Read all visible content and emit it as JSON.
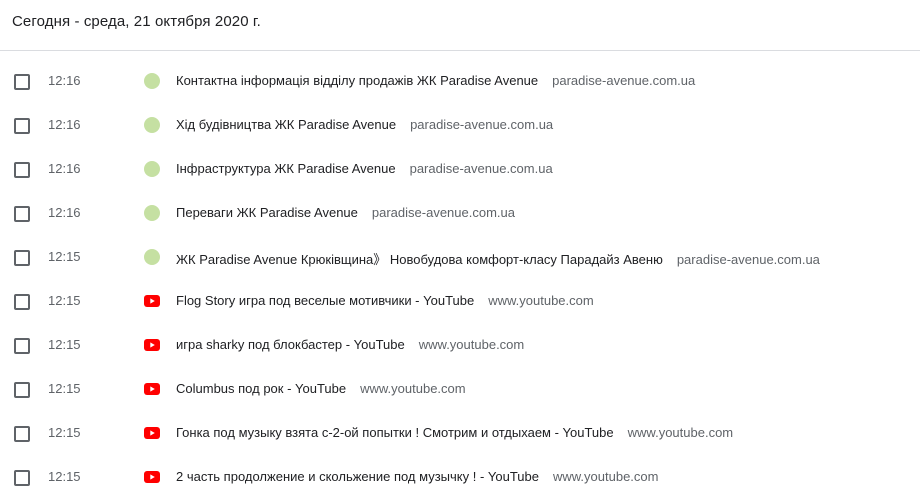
{
  "header": {
    "title": "Сегодня - среда, 21 октября 2020 г."
  },
  "icons": {
    "paradise": "site-favicon-icon",
    "youtube": "youtube-icon"
  },
  "colors": {
    "paradise_favicon": "#c5e0a2",
    "youtube_red": "#ff0000",
    "divider": "#dadce0"
  },
  "entries": [
    {
      "time": "12:16",
      "icon": "paradise",
      "title": "Контактна інформація відділу продажів ЖК Paradise Avenue",
      "domain": "paradise-avenue.com.ua"
    },
    {
      "time": "12:16",
      "icon": "paradise",
      "title": "Хід будівництва ЖК Paradise Avenue",
      "domain": "paradise-avenue.com.ua"
    },
    {
      "time": "12:16",
      "icon": "paradise",
      "title": "Інфраструктура ЖК Paradise Avenue",
      "domain": "paradise-avenue.com.ua"
    },
    {
      "time": "12:16",
      "icon": "paradise",
      "title": "Переваги ЖК Paradise Avenue",
      "domain": "paradise-avenue.com.ua"
    },
    {
      "time": "12:15",
      "icon": "paradise",
      "title": "ЖК Paradise Avenue Крюківщина》 Новобудова комфорт-класу Парадайз Авеню",
      "domain": "paradise-avenue.com.ua"
    },
    {
      "time": "12:15",
      "icon": "youtube",
      "title": "Flog Story игра под веселые мотивчики - YouTube",
      "domain": "www.youtube.com"
    },
    {
      "time": "12:15",
      "icon": "youtube",
      "title": "игра sharky под блокбастер - YouTube",
      "domain": "www.youtube.com"
    },
    {
      "time": "12:15",
      "icon": "youtube",
      "title": "Columbus под рок - YouTube",
      "domain": "www.youtube.com"
    },
    {
      "time": "12:15",
      "icon": "youtube",
      "title": "Гонка под музыку взята с-2-ой попытки ! Смотрим и отдыхаем - YouTube",
      "domain": "www.youtube.com"
    },
    {
      "time": "12:15",
      "icon": "youtube",
      "title": "2 часть продолжение и скольжение под музычку ! - YouTube",
      "domain": "www.youtube.com"
    }
  ]
}
